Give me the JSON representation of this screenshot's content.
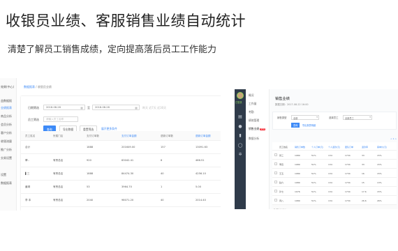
{
  "headline": "收银员业绩、客服销售业绩自动统计",
  "subheadline": "清楚了解员工销售成绩，定向提高落后员工工作能力",
  "left_app": {
    "sidebar_items": [
      {
        "label": "效果(中心)",
        "active": false
      },
      {
        "label": "益数据报",
        "active": false
      },
      {
        "label": "业绩报表",
        "active": true
      },
      {
        "label": "商品分析",
        "active": false
      },
      {
        "label": "会员分析",
        "active": false
      },
      {
        "label": "客户分析",
        "active": false
      },
      {
        "label": "收银流量",
        "active": false
      },
      {
        "label": "推广分析",
        "active": false
      },
      {
        "label": "交易设置",
        "active": false
      },
      {
        "label": "设置",
        "active": false
      },
      {
        "label": "数据报表",
        "active": false
      }
    ],
    "breadcrumb_parent": "数据报表",
    "breadcrumb_sep": "/",
    "breadcrumb_current": "收银员业绩",
    "filter": {
      "date_label": "日期筛选",
      "date_start": "2018-08-28",
      "date_sep": "至",
      "date_end": "2018-08-28",
      "quick_ranges": "昨天  近7天  近30天",
      "staff_label": "员工筛选",
      "staff_placeholder": "请输入员工名称",
      "search_button": "查询",
      "export_button": "导出数据",
      "reset_button": "重置筛选",
      "more_link": "展开更多条件"
    },
    "columns": [
      "员工姓名",
      "所属门店",
      "支付订单数",
      "支付订单金额",
      "退款订单数",
      "退款订单金额"
    ],
    "rows": [
      [
        "合计",
        "",
        "1888",
        "201649.00",
        "157",
        "13091.63"
      ],
      [
        "翠..",
        "有赞总店",
        "920",
        "83042.41",
        "6",
        "466.51"
      ],
      [
        "▌三",
        "有赞总店",
        "1888",
        "84474.30",
        "40",
        "4256.10"
      ],
      [
        "姜琪",
        "有赞总店",
        "53",
        "3964.70",
        "1",
        "5.00"
      ],
      [
        "李 本",
        "有赞总店",
        "2040",
        "98071.20",
        "40",
        "2014.40"
      ]
    ]
  },
  "right_app": {
    "user_label": "已登录",
    "nav_items": [
      {
        "label": "概况",
        "active": false,
        "badge": ""
      },
      {
        "label": "工作量",
        "active": false,
        "badge": ""
      },
      {
        "label": "考勤",
        "active": false,
        "badge": ""
      },
      {
        "label": "绩效管理",
        "active": false,
        "badge": ""
      },
      {
        "label": "销售业绩",
        "active": true,
        "badge": "NEW"
      },
      {
        "label": "数据分析",
        "active": false,
        "badge": ""
      }
    ],
    "dark_icons": [
      "home-icon",
      "user-icon",
      "chart-icon",
      "settings-icon",
      "gear-icon"
    ],
    "title": "销售业绩",
    "date_text": "数据日期：2017-08-22 16:00",
    "filter": {
      "type_label": "销售类型",
      "type_value": "全部",
      "staff_label": "选择员工",
      "staff_value": "全部员工",
      "search_button": "查询",
      "export_link": "导出报表明细"
    },
    "pager": "< 1 >",
    "columns": [
      "员工姓名",
      "销售订单数",
      "个人订单(元)",
      "个人退款(元)",
      "团队订单",
      "退款率",
      "客单价(元)"
    ],
    "rows": [
      [
        "张三",
        "1989",
        "51%",
        "134",
        "1734",
        "33",
        "15%"
      ],
      [
        "李四",
        "1989",
        "51%",
        "134",
        "1734",
        "33",
        "15%"
      ],
      [
        "王五",
        "1989",
        "51%",
        "134",
        "1734",
        "16",
        "15%"
      ],
      [
        "赵六",
        "1989",
        "51%",
        "134",
        "1734",
        "15",
        "13%"
      ],
      [
        "孙七",
        "1976",
        "51%",
        "134",
        "1734",
        "17.6",
        "15%"
      ],
      [
        "周八",
        "1989",
        "51%",
        "134",
        "1734",
        "26.6",
        "26%"
      ]
    ],
    "footer_row": [
      "数据统计合计",
      "1989",
      "51%",
      "13",
      "1988",
      "76",
      "15%"
    ]
  }
}
